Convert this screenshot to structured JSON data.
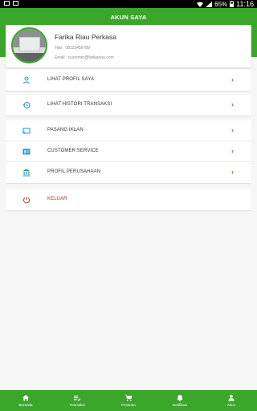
{
  "status_bar": {
    "battery": "65%",
    "time": "11:16"
  },
  "header": {
    "title": "AKUN SAYA"
  },
  "profile": {
    "name": "Farika Riau Perkasa",
    "telp": "Telp : 08123456789",
    "email": "Email : customer@farikariau.com"
  },
  "menu": {
    "group1": [
      {
        "label": "LIHAT PROFIL SAYA",
        "icon": "person-icon"
      }
    ],
    "group2": [
      {
        "label": "LIHAT HISTORI TRANSAKSI",
        "icon": "history-icon"
      }
    ],
    "group3": [
      {
        "label": "PASANG IKLAN",
        "icon": "cast-icon"
      },
      {
        "label": "CUSTOMER SERVICE",
        "icon": "contact-card-icon"
      },
      {
        "label": "PROFIL PERUSAHAAN",
        "icon": "bank-icon"
      }
    ],
    "group4": [
      {
        "label": "KELUAR",
        "icon": "power-icon"
      }
    ],
    "chevron": "›"
  },
  "bottom_nav": [
    {
      "label": "Beranda",
      "icon": "home-icon"
    },
    {
      "label": "Transaksi",
      "icon": "list-icon"
    },
    {
      "label": "Pesanan",
      "icon": "cart-icon"
    },
    {
      "label": "Notifikasi",
      "icon": "bell-icon"
    },
    {
      "label": "Akun",
      "icon": "account-icon"
    }
  ],
  "colors": {
    "primary": "#3aa62a",
    "icon_blue": "#2196c8",
    "logout_red": "#c62828"
  }
}
